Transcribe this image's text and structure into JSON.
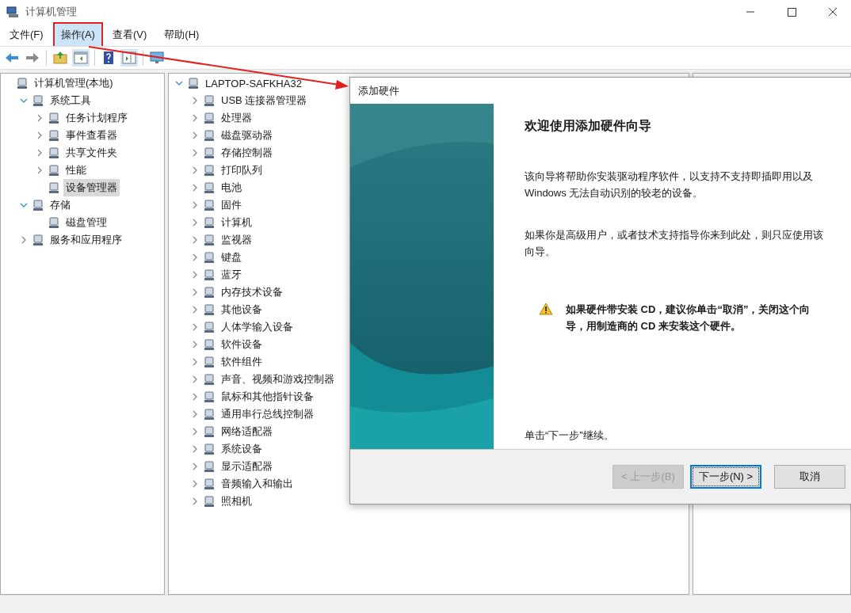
{
  "window": {
    "title": "计算机管理"
  },
  "menu": [
    {
      "label": "文件(F)",
      "selected": false,
      "highlighted": false
    },
    {
      "label": "操作(A)",
      "selected": true,
      "highlighted": true
    },
    {
      "label": "查看(V)",
      "selected": false,
      "highlighted": false
    },
    {
      "label": "帮助(H)",
      "selected": false,
      "highlighted": false
    }
  ],
  "annotations": [
    {
      "kind": "arrow"
    }
  ],
  "console_tree": [
    {
      "label": "计算机管理(本地)",
      "kind": "root",
      "selected": false,
      "children": [
        {
          "label": "系统工具",
          "kind": "branch",
          "expanded": true,
          "selected": false,
          "children": [
            {
              "label": "任务计划程序",
              "kind": "branch",
              "expanded": false,
              "selected": false
            },
            {
              "label": "事件查看器",
              "kind": "branch",
              "expanded": false,
              "selected": false
            },
            {
              "label": "共享文件夹",
              "kind": "branch",
              "expanded": false,
              "selected": false
            },
            {
              "label": "性能",
              "kind": "branch",
              "expanded": false,
              "selected": false
            },
            {
              "label": "设备管理器",
              "kind": "leaf",
              "selected": true
            }
          ]
        },
        {
          "label": "存储",
          "kind": "branch",
          "expanded": true,
          "selected": false,
          "children": [
            {
              "label": "磁盘管理",
              "kind": "leaf",
              "selected": false
            }
          ]
        },
        {
          "label": "服务和应用程序",
          "kind": "branch",
          "expanded": false,
          "selected": false
        }
      ]
    }
  ],
  "device_tree": [
    {
      "label": "LAPTOP-SAFKHA32",
      "kind": "branch",
      "expanded": true,
      "selected": false,
      "children": [
        {
          "label": "USB 连接器管理器",
          "kind": "branch",
          "expanded": false,
          "selected": false
        },
        {
          "label": "处理器",
          "kind": "branch",
          "expanded": false,
          "selected": false
        },
        {
          "label": "磁盘驱动器",
          "kind": "branch",
          "expanded": false,
          "selected": false
        },
        {
          "label": "存储控制器",
          "kind": "branch",
          "expanded": false,
          "selected": false
        },
        {
          "label": "打印队列",
          "kind": "branch",
          "expanded": false,
          "selected": false
        },
        {
          "label": "电池",
          "kind": "branch",
          "expanded": false,
          "selected": false
        },
        {
          "label": "固件",
          "kind": "branch",
          "expanded": false,
          "selected": false
        },
        {
          "label": "计算机",
          "kind": "branch",
          "expanded": false,
          "selected": false
        },
        {
          "label": "监视器",
          "kind": "branch",
          "expanded": false,
          "selected": false
        },
        {
          "label": "键盘",
          "kind": "branch",
          "expanded": false,
          "selected": false
        },
        {
          "label": "蓝牙",
          "kind": "branch",
          "expanded": false,
          "selected": false
        },
        {
          "label": "内存技术设备",
          "kind": "branch",
          "expanded": false,
          "selected": false
        },
        {
          "label": "其他设备",
          "kind": "branch",
          "expanded": false,
          "selected": false
        },
        {
          "label": "人体学输入设备",
          "kind": "branch",
          "expanded": false,
          "selected": false
        },
        {
          "label": "软件设备",
          "kind": "branch",
          "expanded": false,
          "selected": false
        },
        {
          "label": "软件组件",
          "kind": "branch",
          "expanded": false,
          "selected": false
        },
        {
          "label": "声音、视频和游戏控制器",
          "kind": "branch",
          "expanded": false,
          "selected": false
        },
        {
          "label": "鼠标和其他指针设备",
          "kind": "branch",
          "expanded": false,
          "selected": false
        },
        {
          "label": "通用串行总线控制器",
          "kind": "branch",
          "expanded": false,
          "selected": false
        },
        {
          "label": "网络适配器",
          "kind": "branch",
          "expanded": false,
          "selected": false
        },
        {
          "label": "系统设备",
          "kind": "branch",
          "expanded": false,
          "selected": false
        },
        {
          "label": "显示适配器",
          "kind": "branch",
          "expanded": false,
          "selected": false
        },
        {
          "label": "音频输入和输出",
          "kind": "branch",
          "expanded": false,
          "selected": false
        },
        {
          "label": "照相机",
          "kind": "branch",
          "expanded": false,
          "selected": false
        }
      ]
    }
  ],
  "dialog": {
    "title": "添加硬件",
    "heading": "欢迎使用添加硬件向导",
    "paragraphs": [
      "该向导将帮助你安装驱动程序软件，以支持不支持即插即用以及 Windows 无法自动识别的较老的设备。",
      "如果你是高级用户，或者技术支持指导你来到此处，则只应使用该向导。"
    ],
    "warning": "如果硬件带安装 CD，建议你单击“取消”，关闭这个向导，用制造商的 CD 来安装这个硬件。",
    "footer_note": "单击“下一步”继续。",
    "buttons": [
      {
        "label": "< 上一步(B)",
        "disabled": true,
        "default": false
      },
      {
        "label": "下一步(N) >",
        "disabled": false,
        "default": true
      },
      {
        "label": "取消",
        "disabled": false,
        "default": false
      }
    ]
  }
}
